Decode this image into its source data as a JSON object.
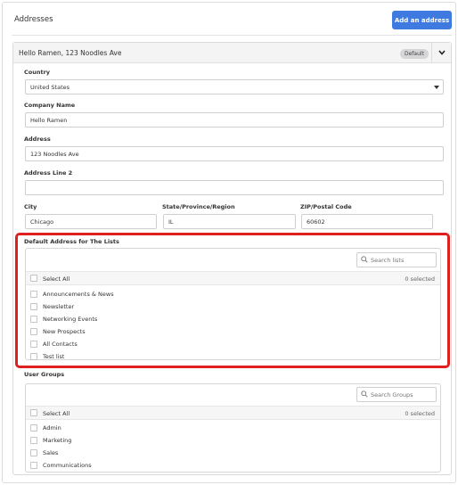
{
  "header": {
    "title": "Addresses",
    "add_button": "Add an address"
  },
  "card": {
    "title": "Hello Ramen, 123 Noodles Ave",
    "badge": "Default"
  },
  "form": {
    "country_label": "Country",
    "country_value": "United States",
    "company_label": "Company Name",
    "company_value": "Hello Ramen",
    "address_label": "Address",
    "address_value": "123 Noodles Ave",
    "address2_label": "Address Line 2",
    "address2_value": "",
    "city_label": "City",
    "city_value": "Chicago",
    "state_label": "State/Province/Region",
    "state_value": "IL",
    "zip_label": "ZIP/Postal Code",
    "zip_value": "60602"
  },
  "lists": {
    "label": "Default Address for The Lists",
    "search_placeholder": "Search lists",
    "select_all": "Select All",
    "selected_count": "0 selected",
    "items": [
      "Announcements & News",
      "Newsletter",
      "Networking Events",
      "New Prospects",
      "All Contacts",
      "Test list"
    ]
  },
  "groups": {
    "label": "User Groups",
    "search_placeholder": "Search Groups",
    "select_all": "Select All",
    "selected_count": "0 selected",
    "items": [
      "Admin",
      "Marketing",
      "Sales",
      "Communications"
    ]
  },
  "colors": {
    "primary": "#3e7ae0",
    "highlight": "#e01f1f"
  }
}
